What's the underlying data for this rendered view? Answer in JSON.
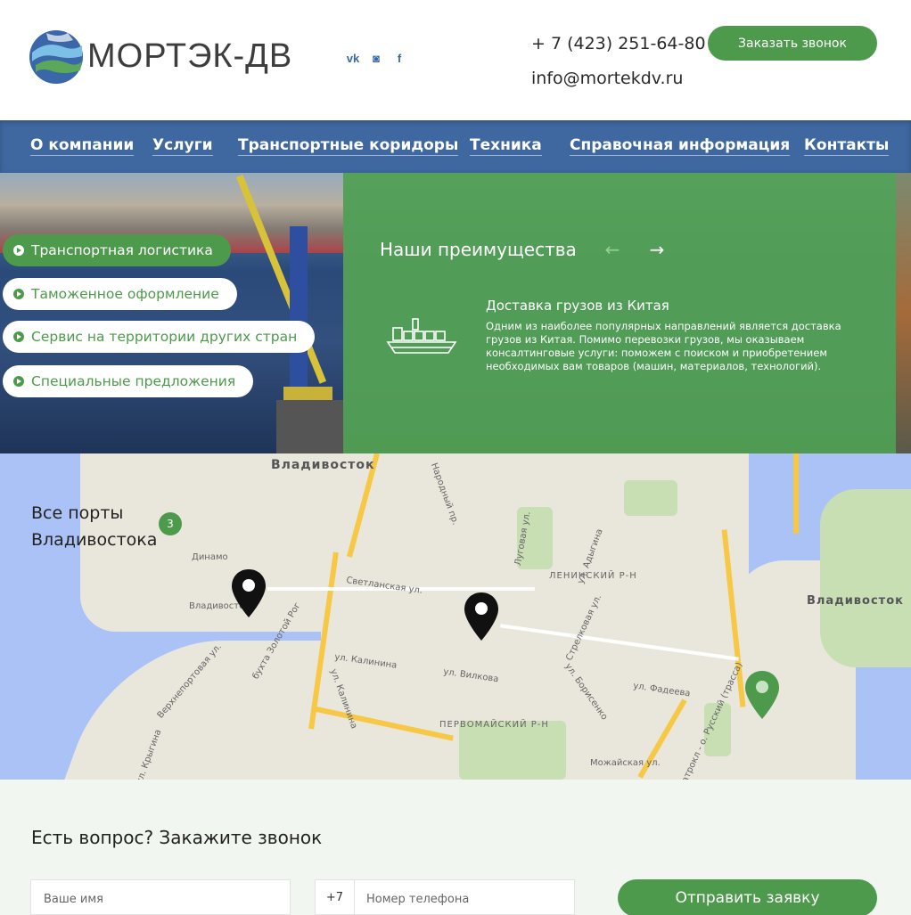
{
  "header": {
    "logo_text": "МОРТЭК-ДВ",
    "socials": [
      {
        "icon": "vk-icon",
        "glyph": "vk"
      },
      {
        "icon": "instagram-icon",
        "glyph": "◙"
      },
      {
        "icon": "facebook-icon",
        "glyph": "f"
      }
    ],
    "phone": "+ 7 (423) 251-64-80",
    "email": "info@mortekdv.ru",
    "callback_label": "Заказать звонок"
  },
  "nav": {
    "items": [
      {
        "label": "О компании"
      },
      {
        "label": "Услуги"
      },
      {
        "label": "Транспортные коридоры"
      },
      {
        "label": "Техника"
      },
      {
        "label": "Справочная информация"
      },
      {
        "label": "Контакты"
      }
    ]
  },
  "hero": {
    "menu": [
      {
        "label": "Транспортная логистика",
        "active": true
      },
      {
        "label": "Таможенное оформление",
        "active": false
      },
      {
        "label": "Сервис на территории других стран",
        "active": false
      },
      {
        "label": "Специальные предложения",
        "active": false
      }
    ],
    "advantages": {
      "title": "Наши преимущества",
      "prev_glyph": "←",
      "next_glyph": "→",
      "item_title": "Доставка грузов из Китая",
      "item_text": "Одним из наиболее популярных направлений является доставка грузов из Китая. Помимо перевозки грузов, мы оказываем консалтинговые услуги: поможем с поиском и приобретением необходимых вам товаров (машин, материалов, технологий)."
    }
  },
  "map": {
    "title_line1": "Все порты",
    "title_line2": "Владивостока",
    "badge_count": "3",
    "labels": {
      "city_top": "Владивосток",
      "city_right": "Владивосток",
      "leninsky": "ЛЕНИНСКИЙ Р-Н",
      "pervomaysky": "ПЕРВОМАЙСКИЙ Р-Н",
      "dinamo": "Динамо",
      "vladivostok_station": "Владивосто",
      "svetlanskaya": "Светланская ул.",
      "zolotoy_rog": "бухта Золотой Рог",
      "kalinina1": "ул. Калинина",
      "kalinina2": "ул. Калинина",
      "vilkova": "ул. Вилкова",
      "fadeeva": "ул. Фадеева",
      "narodny": "Народный пр.",
      "lugovaya": "Луговая ул.",
      "verkhneportovaya": "Верхнепортовая ул.",
      "kryg": "ул. Крыгина",
      "mozhayskaya": "Можайская ул.",
      "strelkovaya": "Стрелковая ул.",
      "borisenko": "ул. Борисенко",
      "russky": "Патрокл - о. Русский (трасса)",
      "padygina": "ул. Адыгина"
    }
  },
  "form": {
    "title": "Есть вопрос? Закажите звонок",
    "name_placeholder": "Ваше имя",
    "phone_prefix": "+7",
    "phone_placeholder": "Номер телефона",
    "submit_label": "Отправить заявку"
  },
  "colors": {
    "brand_green": "#4e9a4d",
    "nav_blue": "#3f67a0",
    "water": "#aac2f5"
  }
}
